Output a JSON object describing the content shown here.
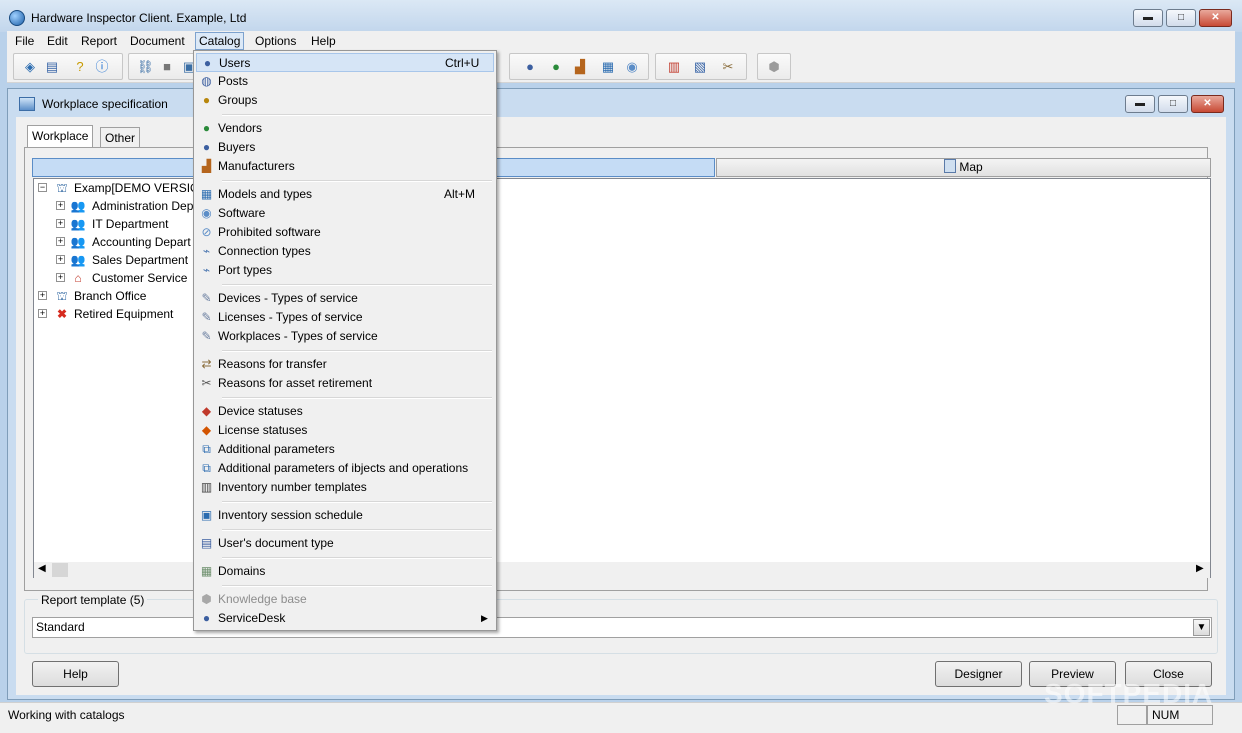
{
  "app": {
    "title": "Hardware Inspector Client. Example, Ltd"
  },
  "title_buttons": {
    "minimize": "▬",
    "maximize": "□",
    "close": "✕"
  },
  "menu": [
    "File",
    "Edit",
    "Report",
    "Document",
    "Catalog",
    "Options",
    "Help"
  ],
  "child_window": {
    "title": "Workplace specification",
    "tabs": [
      "Workplace",
      "Other"
    ],
    "map_label": "Map",
    "tree": [
      {
        "label": "Examp[DEMO VERSIO",
        "icon": "org-chart-icon"
      },
      {
        "label": "Administration Dep",
        "icon": "group-icon"
      },
      {
        "label": "IT Department",
        "icon": "group-icon"
      },
      {
        "label": "Accounting Depart",
        "icon": "group-icon"
      },
      {
        "label": "Sales Department",
        "icon": "group-icon"
      },
      {
        "label": "Customer Service",
        "icon": "house-icon"
      },
      {
        "label": "Branch Office",
        "icon": "org-chart-icon"
      },
      {
        "label": "Retired Equipment",
        "icon": "red-cross-icon"
      }
    ],
    "report_template": {
      "label": "Report template (5)",
      "value": "Standard"
    },
    "buttons": {
      "help": "Help",
      "designer": "Designer",
      "preview": "Preview",
      "close": "Close"
    }
  },
  "catalog_menu": [
    {
      "label": "Users",
      "shortcut": "Ctrl+U",
      "icon": "user-icon"
    },
    {
      "label": "Posts",
      "icon": "post-icon"
    },
    {
      "label": "Groups",
      "icon": "group-icon"
    },
    {
      "label": "Vendors",
      "icon": "vendor-icon"
    },
    {
      "label": "Buyers",
      "icon": "buyer-icon"
    },
    {
      "label": "Manufacturers",
      "icon": "factory-icon"
    },
    {
      "label": "Models and types",
      "shortcut": "Alt+M",
      "icon": "models-icon"
    },
    {
      "label": "Software",
      "icon": "software-icon"
    },
    {
      "label": "Prohibited software",
      "icon": "prohibited-icon"
    },
    {
      "label": "Connection types",
      "icon": "connection-icon"
    },
    {
      "label": "Port types",
      "icon": "port-icon"
    },
    {
      "label": "Devices - Types of service",
      "icon": "device-service-icon"
    },
    {
      "label": "Licenses - Types of service",
      "icon": "license-service-icon"
    },
    {
      "label": "Workplaces - Types of service",
      "icon": "workplace-service-icon"
    },
    {
      "label": "Reasons for transfer",
      "icon": "transfer-icon"
    },
    {
      "label": "Reasons for asset retirement",
      "icon": "retirement-icon"
    },
    {
      "label": "Device statuses",
      "icon": "device-status-icon"
    },
    {
      "label": "License statuses",
      "icon": "license-status-icon"
    },
    {
      "label": "Additional parameters",
      "icon": "params-icon"
    },
    {
      "label": "Additional parameters of ibjects and operations",
      "icon": "params-icon"
    },
    {
      "label": "Inventory number templates",
      "icon": "barcode-icon"
    },
    {
      "label": "Inventory session schedule",
      "icon": "schedule-icon"
    },
    {
      "label": "User's document type",
      "icon": "document-type-icon"
    },
    {
      "label": "Domains",
      "icon": "domains-icon"
    },
    {
      "label": "Knowledge base",
      "icon": "knowledge-icon",
      "disabled": true
    },
    {
      "label": "ServiceDesk",
      "icon": "servicedesk-icon"
    }
  ],
  "status": {
    "text": "Working with catalogs",
    "num": "NUM"
  },
  "watermark": "SOFTPEDIA",
  "colors": {
    "accent": "#c5dcf5",
    "titlebar": "#c2d6ec",
    "menu_highlight": "#d6e5f6"
  }
}
